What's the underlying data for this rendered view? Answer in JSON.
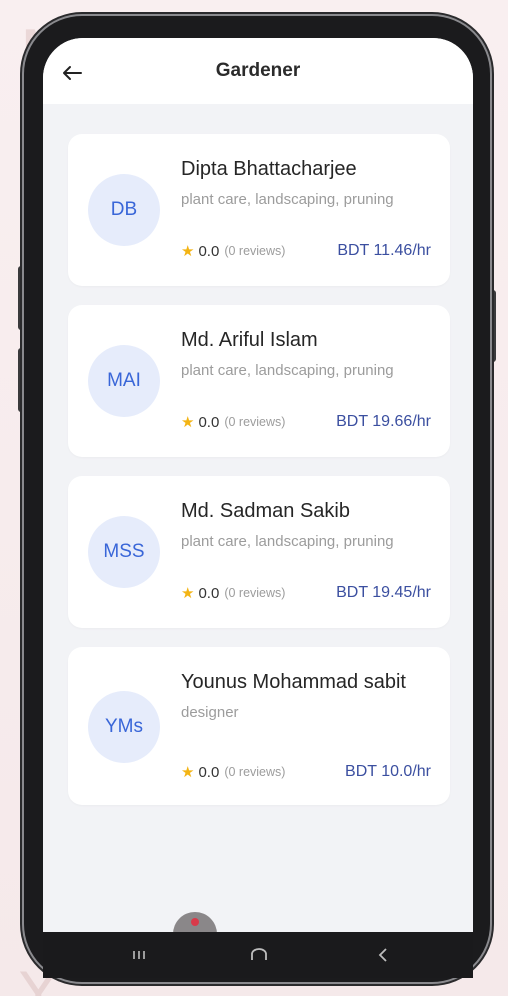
{
  "header": {
    "title": "Gardener",
    "back_icon": "arrow-left-icon"
  },
  "workers": [
    {
      "initials": "DB",
      "name": "Dipta Bhattacharjee",
      "skills": "plant care, landscaping, pruning",
      "rating": "0.0",
      "reviews": "(0 reviews)",
      "rate": "BDT 11.46/hr"
    },
    {
      "initials": "MAI",
      "name": "Md. Ariful Islam",
      "skills": "plant care, landscaping, pruning",
      "rating": "0.0",
      "reviews": "(0 reviews)",
      "rate": "BDT 19.66/hr"
    },
    {
      "initials": "MSS",
      "name": "Md. Sadman Sakib",
      "skills": "plant care, landscaping, pruning",
      "rating": "0.0",
      "reviews": "(0 reviews)",
      "rate": "BDT 19.45/hr"
    },
    {
      "initials": "YMs",
      "name": "Younus Mohammad sabit",
      "skills": "designer",
      "rating": "0.0",
      "reviews": "(0 reviews)",
      "rate": "BDT 10.0/hr"
    }
  ],
  "colors": {
    "accent": "#3966d8",
    "price": "#3b4fa0",
    "star": "#f3b414",
    "avatar_bg": "#e6ecfb",
    "screen_bg": "#f2f3f6"
  },
  "icons": {
    "star": "star-icon",
    "nav_recents": "recents-icon",
    "nav_home": "home-icon",
    "nav_back": "back-chevron-icon"
  }
}
